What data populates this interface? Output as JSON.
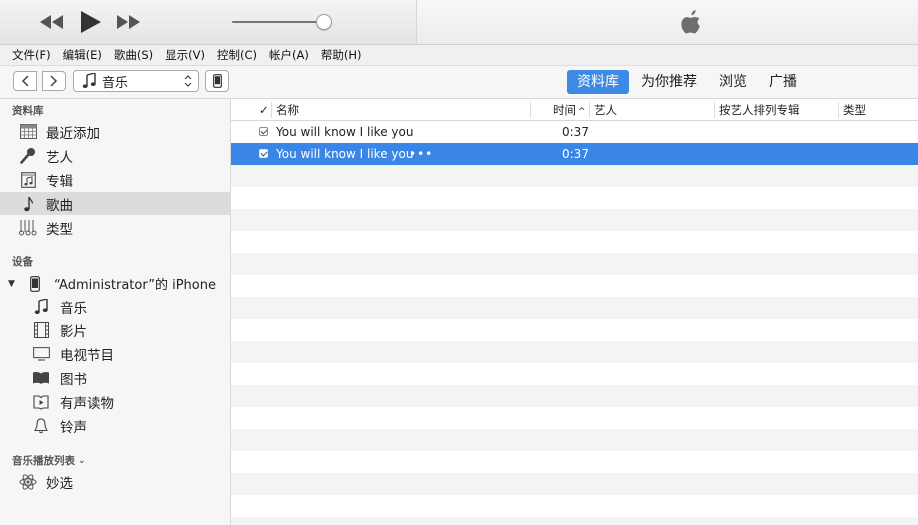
{
  "transport": {
    "volume_level": 0.95
  },
  "menu": [
    "文件(F)",
    "编辑(E)",
    "歌曲(S)",
    "显示(V)",
    "控制(C)",
    "帐户(A)",
    "帮助(H)"
  ],
  "nav": {
    "media_label": "音乐",
    "tabs": [
      {
        "label": "资料库",
        "active": true
      },
      {
        "label": "为你推荐",
        "active": false
      },
      {
        "label": "浏览",
        "active": false
      },
      {
        "label": "广播",
        "active": false
      }
    ]
  },
  "sidebar": {
    "library_title": "资料库",
    "library": [
      {
        "label": "最近添加",
        "icon": "grid-icon"
      },
      {
        "label": "艺人",
        "icon": "microphone-icon"
      },
      {
        "label": "专辑",
        "icon": "album-icon"
      },
      {
        "label": "歌曲",
        "icon": "music-note-icon",
        "selected": true
      },
      {
        "label": "类型",
        "icon": "genre-icon"
      }
    ],
    "devices_title": "设备",
    "device_name": "“Administrator”的 iPhone",
    "device_items": [
      {
        "label": "音乐",
        "icon": "music-note-icon"
      },
      {
        "label": "影片",
        "icon": "film-icon"
      },
      {
        "label": "电视节目",
        "icon": "tv-icon"
      },
      {
        "label": "图书",
        "icon": "book-icon"
      },
      {
        "label": "有声读物",
        "icon": "audiobook-icon"
      },
      {
        "label": "铃声",
        "icon": "bell-icon"
      }
    ],
    "playlists_title": "音乐播放列表",
    "playlists": [
      {
        "label": "妙选",
        "icon": "atom-icon"
      }
    ]
  },
  "songs": {
    "columns": {
      "check": "✓",
      "name": "名称",
      "time": "时间",
      "artist": "艺人",
      "album_by_artist": "按艺人排列专辑",
      "genre": "类型"
    },
    "rows": [
      {
        "name": "You will know I like you",
        "time": "0:37",
        "selected": false
      },
      {
        "name": "You will know I like you",
        "more": "•••",
        "time": "0:37",
        "selected": true
      }
    ]
  }
}
